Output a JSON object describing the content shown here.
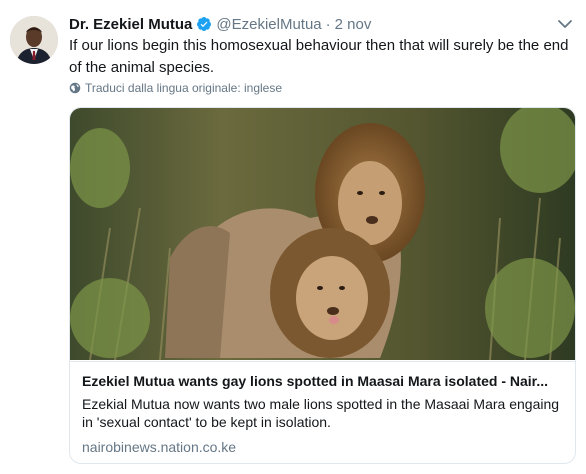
{
  "author": {
    "name": "Dr. Ezekiel Mutua",
    "handle": "@EzekielMutua",
    "separator": "·",
    "date": "2 nov",
    "avatar_icon": "profile-photo",
    "verified_icon": "verified-badge-icon"
  },
  "tweet": {
    "text": "If our lions begin this homosexual behaviour then that will surely be the end of the animal species."
  },
  "translate": {
    "label": "Traduci dalla lingua originale: inglese",
    "icon": "globe-icon"
  },
  "card": {
    "title": "Ezekiel Mutua wants gay lions spotted in Maasai Mara isolated - Nair...",
    "description": "Ezekial Mutua now wants two male lions spotted in the Masaai Mara engaing in 'sexual contact' to be kept in isolation.",
    "domain": "nairobinews.nation.co.ke",
    "image_icon": "lions-photo"
  },
  "colors": {
    "accent": "#1da1f2",
    "secondary_text": "#657786",
    "border": "#e1e8ed"
  }
}
